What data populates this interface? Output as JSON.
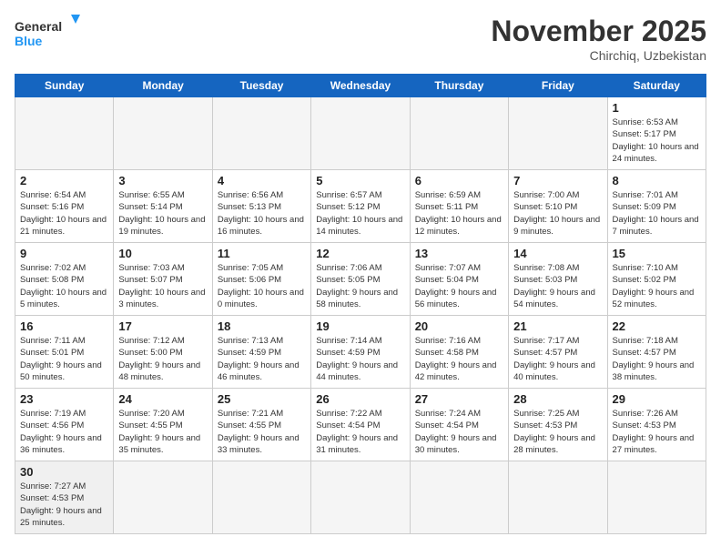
{
  "header": {
    "logo_general": "General",
    "logo_blue": "Blue",
    "month_title": "November 2025",
    "location": "Chirchiq, Uzbekistan"
  },
  "days_of_week": [
    "Sunday",
    "Monday",
    "Tuesday",
    "Wednesday",
    "Thursday",
    "Friday",
    "Saturday"
  ],
  "weeks": [
    [
      {
        "day": "",
        "info": ""
      },
      {
        "day": "",
        "info": ""
      },
      {
        "day": "",
        "info": ""
      },
      {
        "day": "",
        "info": ""
      },
      {
        "day": "",
        "info": ""
      },
      {
        "day": "",
        "info": ""
      },
      {
        "day": "1",
        "info": "Sunrise: 6:53 AM\nSunset: 5:17 PM\nDaylight: 10 hours and 24 minutes."
      }
    ],
    [
      {
        "day": "2",
        "info": "Sunrise: 6:54 AM\nSunset: 5:16 PM\nDaylight: 10 hours and 21 minutes."
      },
      {
        "day": "3",
        "info": "Sunrise: 6:55 AM\nSunset: 5:14 PM\nDaylight: 10 hours and 19 minutes."
      },
      {
        "day": "4",
        "info": "Sunrise: 6:56 AM\nSunset: 5:13 PM\nDaylight: 10 hours and 16 minutes."
      },
      {
        "day": "5",
        "info": "Sunrise: 6:57 AM\nSunset: 5:12 PM\nDaylight: 10 hours and 14 minutes."
      },
      {
        "day": "6",
        "info": "Sunrise: 6:59 AM\nSunset: 5:11 PM\nDaylight: 10 hours and 12 minutes."
      },
      {
        "day": "7",
        "info": "Sunrise: 7:00 AM\nSunset: 5:10 PM\nDaylight: 10 hours and 9 minutes."
      },
      {
        "day": "8",
        "info": "Sunrise: 7:01 AM\nSunset: 5:09 PM\nDaylight: 10 hours and 7 minutes."
      }
    ],
    [
      {
        "day": "9",
        "info": "Sunrise: 7:02 AM\nSunset: 5:08 PM\nDaylight: 10 hours and 5 minutes."
      },
      {
        "day": "10",
        "info": "Sunrise: 7:03 AM\nSunset: 5:07 PM\nDaylight: 10 hours and 3 minutes."
      },
      {
        "day": "11",
        "info": "Sunrise: 7:05 AM\nSunset: 5:06 PM\nDaylight: 10 hours and 0 minutes."
      },
      {
        "day": "12",
        "info": "Sunrise: 7:06 AM\nSunset: 5:05 PM\nDaylight: 9 hours and 58 minutes."
      },
      {
        "day": "13",
        "info": "Sunrise: 7:07 AM\nSunset: 5:04 PM\nDaylight: 9 hours and 56 minutes."
      },
      {
        "day": "14",
        "info": "Sunrise: 7:08 AM\nSunset: 5:03 PM\nDaylight: 9 hours and 54 minutes."
      },
      {
        "day": "15",
        "info": "Sunrise: 7:10 AM\nSunset: 5:02 PM\nDaylight: 9 hours and 52 minutes."
      }
    ],
    [
      {
        "day": "16",
        "info": "Sunrise: 7:11 AM\nSunset: 5:01 PM\nDaylight: 9 hours and 50 minutes."
      },
      {
        "day": "17",
        "info": "Sunrise: 7:12 AM\nSunset: 5:00 PM\nDaylight: 9 hours and 48 minutes."
      },
      {
        "day": "18",
        "info": "Sunrise: 7:13 AM\nSunset: 4:59 PM\nDaylight: 9 hours and 46 minutes."
      },
      {
        "day": "19",
        "info": "Sunrise: 7:14 AM\nSunset: 4:59 PM\nDaylight: 9 hours and 44 minutes."
      },
      {
        "day": "20",
        "info": "Sunrise: 7:16 AM\nSunset: 4:58 PM\nDaylight: 9 hours and 42 minutes."
      },
      {
        "day": "21",
        "info": "Sunrise: 7:17 AM\nSunset: 4:57 PM\nDaylight: 9 hours and 40 minutes."
      },
      {
        "day": "22",
        "info": "Sunrise: 7:18 AM\nSunset: 4:57 PM\nDaylight: 9 hours and 38 minutes."
      }
    ],
    [
      {
        "day": "23",
        "info": "Sunrise: 7:19 AM\nSunset: 4:56 PM\nDaylight: 9 hours and 36 minutes."
      },
      {
        "day": "24",
        "info": "Sunrise: 7:20 AM\nSunset: 4:55 PM\nDaylight: 9 hours and 35 minutes."
      },
      {
        "day": "25",
        "info": "Sunrise: 7:21 AM\nSunset: 4:55 PM\nDaylight: 9 hours and 33 minutes."
      },
      {
        "day": "26",
        "info": "Sunrise: 7:22 AM\nSunset: 4:54 PM\nDaylight: 9 hours and 31 minutes."
      },
      {
        "day": "27",
        "info": "Sunrise: 7:24 AM\nSunset: 4:54 PM\nDaylight: 9 hours and 30 minutes."
      },
      {
        "day": "28",
        "info": "Sunrise: 7:25 AM\nSunset: 4:53 PM\nDaylight: 9 hours and 28 minutes."
      },
      {
        "day": "29",
        "info": "Sunrise: 7:26 AM\nSunset: 4:53 PM\nDaylight: 9 hours and 27 minutes."
      }
    ],
    [
      {
        "day": "30",
        "info": "Sunrise: 7:27 AM\nSunset: 4:53 PM\nDaylight: 9 hours and 25 minutes."
      },
      {
        "day": "",
        "info": ""
      },
      {
        "day": "",
        "info": ""
      },
      {
        "day": "",
        "info": ""
      },
      {
        "day": "",
        "info": ""
      },
      {
        "day": "",
        "info": ""
      },
      {
        "day": "",
        "info": ""
      }
    ]
  ]
}
